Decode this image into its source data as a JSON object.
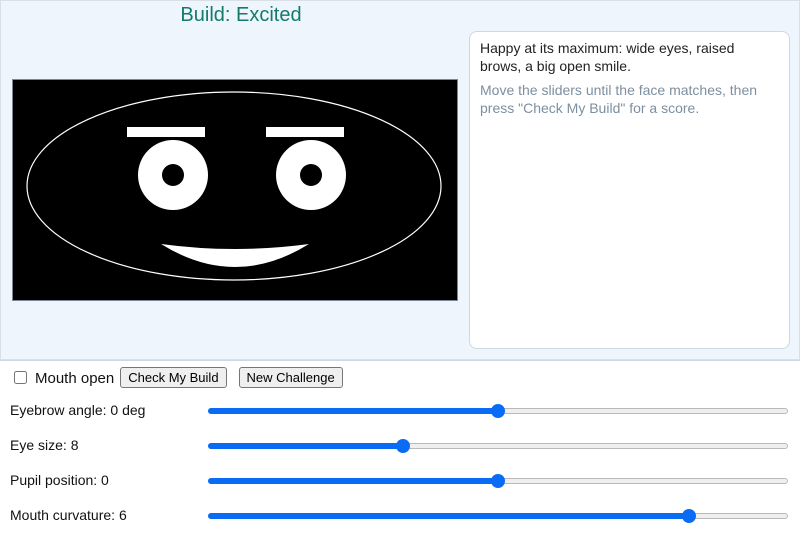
{
  "title": "Build: Excited",
  "info": {
    "description": "Happy at its maximum: wide eyes, raised brows, a big open smile.",
    "hint": "Move the sliders until the face matches, then press \"Check My Build\" for a score."
  },
  "controls": {
    "mouth_open_label": "Mouth open",
    "mouth_open_checked": false,
    "check_button": "Check My Build",
    "new_button": "New Challenge"
  },
  "sliders": [
    {
      "label": "Eyebrow angle: 0 deg",
      "value": 0.5
    },
    {
      "label": "Eye size: 8",
      "value": 0.335
    },
    {
      "label": "Pupil position: 0",
      "value": 0.5
    },
    {
      "label": "Mouth curvature: 6",
      "value": 0.83
    }
  ],
  "colors": {
    "accent": "#0a6cf4",
    "title": "#147a6a",
    "canvas_bg": "#000000",
    "face": "#ffffff"
  }
}
